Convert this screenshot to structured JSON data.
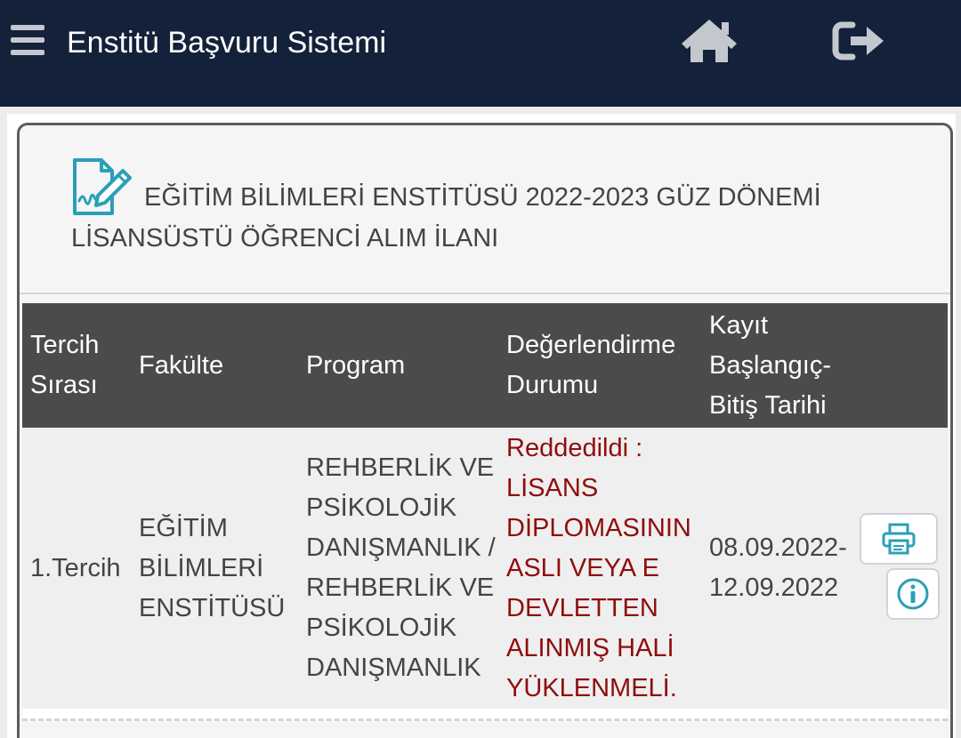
{
  "header": {
    "title": "Enstitü Başvuru Sistemi",
    "menu_icon": "hamburger-menu-icon",
    "home_icon": "home-icon",
    "logout_icon": "sign-out-icon"
  },
  "panel": {
    "heading": "EĞİTİM BİLİMLERİ ENSTİTÜSÜ 2022-2023 GÜZ DÖNEMİ LİSANSÜSTÜ ÖĞRENCİ ALIM İLANI",
    "heading_icon": "signed-document-icon"
  },
  "table": {
    "columns": {
      "preference": "Tercih Sırası",
      "faculty": "Fakülte",
      "program": "Program",
      "evaluation": "Değerlendirme Durumu",
      "registration": "Kayıt Başlangıç-Bitiş Tarihi"
    },
    "rows": [
      {
        "preference": "1.Tercih",
        "faculty": "EĞİTİM BİLİMLERİ ENSTİTÜSÜ",
        "program": "REHBERLİK VE PSİKOLOJİK DANIŞMANLIK / REHBERLİK VE PSİKOLOJİK DANIŞMANLIK",
        "evaluation": "Reddedildi : LİSANS DİPLOMASININ ASLI VEYA E DEVLETTEN ALINMIŞ HALİ YÜKLENMELİ.",
        "registration": "08.09.2022-12.09.2022",
        "actions": [
          "print-icon",
          "info-icon"
        ]
      }
    ]
  },
  "colors": {
    "topbar": "#13213a",
    "table_header": "#4b4b4b",
    "status_rejected": "#8f0d0d",
    "icon_accent": "#2a9fb8"
  }
}
